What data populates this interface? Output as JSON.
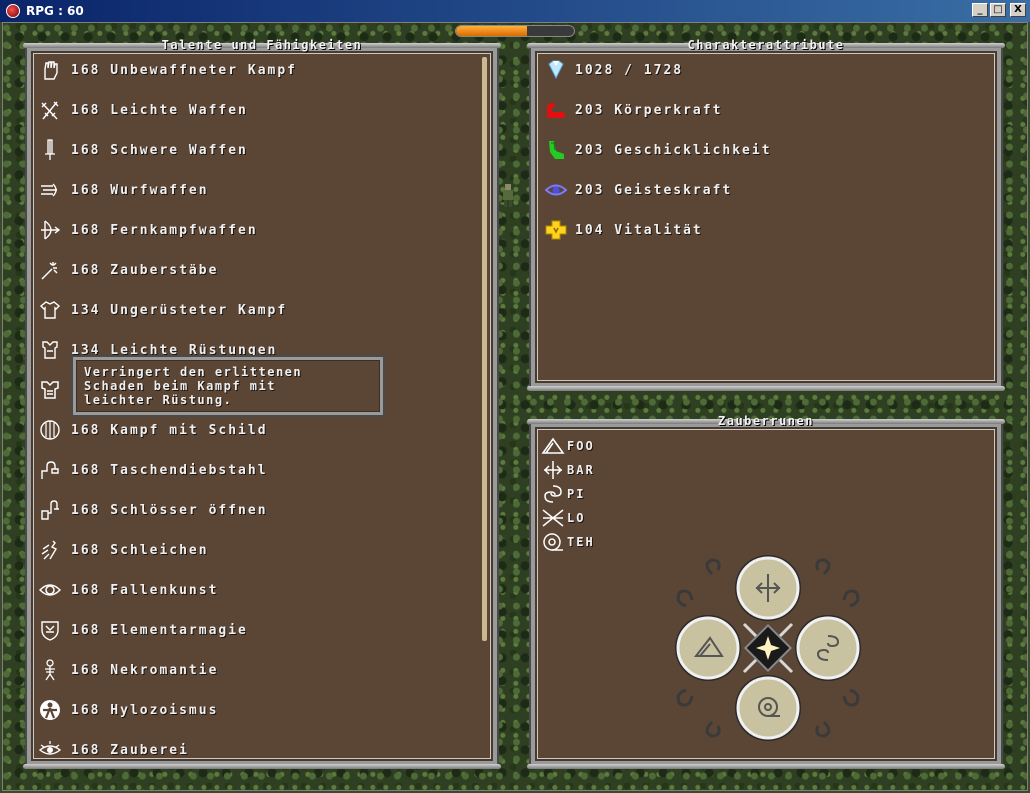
{
  "window": {
    "title": "RPG : 60",
    "btn_min": "_",
    "btn_max": "□",
    "btn_close": "X"
  },
  "hud": {
    "health_fraction": 0.6
  },
  "talents": {
    "title": "Talente und Fähigkeiten",
    "items": [
      {
        "value": "168",
        "name": "Unbewaffneter Kampf",
        "icon": "fist-icon"
      },
      {
        "value": "168",
        "name": "Leichte Waffen",
        "icon": "daggers-icon"
      },
      {
        "value": "168",
        "name": "Schwere Waffen",
        "icon": "sword-icon"
      },
      {
        "value": "168",
        "name": "Wurfwaffen",
        "icon": "throwing-star-icon"
      },
      {
        "value": "168",
        "name": "Fernkampfwaffen",
        "icon": "bow-icon"
      },
      {
        "value": "168",
        "name": "Zauberstäbe",
        "icon": "wand-icon"
      },
      {
        "value": "134",
        "name": "Ungerüsteter Kampf",
        "icon": "shirt-icon"
      },
      {
        "value": "134",
        "name": "Leichte Rüstungen",
        "icon": "light-armor-icon"
      },
      {
        "value": "",
        "name": "",
        "icon": "heavy-armor-icon"
      },
      {
        "value": "168",
        "name": "Kampf mit Schild",
        "icon": "shield-icon"
      },
      {
        "value": "168",
        "name": "Taschendiebstahl",
        "icon": "hand-icon"
      },
      {
        "value": "168",
        "name": "Schlösser öffnen",
        "icon": "lock-icon"
      },
      {
        "value": "168",
        "name": "Schleichen",
        "icon": "sneak-icon"
      },
      {
        "value": "168",
        "name": "Fallenkunst",
        "icon": "eye-trap-icon"
      },
      {
        "value": "168",
        "name": "Elementarmagie",
        "icon": "element-shield-icon"
      },
      {
        "value": "168",
        "name": "Nekromantie",
        "icon": "skeleton-icon"
      },
      {
        "value": "168",
        "name": "Hylozoismus",
        "icon": "nature-icon"
      },
      {
        "value": "168",
        "name": "Zauberei",
        "icon": "sorcery-eye-icon"
      }
    ],
    "tooltip": {
      "lines": [
        "Verringert den erlittenen",
        "Schaden beim Kampf mit",
        "leichter Rüstung."
      ]
    }
  },
  "attributes": {
    "title": "Charakterattribute",
    "items": [
      {
        "text": "1028 / 1728",
        "icon": "heart-crystal-icon",
        "color": "#a8e0ff"
      },
      {
        "text": "203 Körperkraft",
        "icon": "strength-arm-icon",
        "color": "#e01010"
      },
      {
        "text": "203 Geschicklichkeit",
        "icon": "dexterity-foot-icon",
        "color": "#22cc22"
      },
      {
        "text": "203 Geisteskraft",
        "icon": "mind-eye-icon",
        "color": "#6a6aff"
      },
      {
        "text": "104 Vitalität",
        "icon": "vitality-cross-icon",
        "color": "#ffd21c"
      }
    ]
  },
  "runes": {
    "title": "Zauberrunen",
    "items": [
      {
        "name": "FOO",
        "icon": "rune-triangle-icon"
      },
      {
        "name": "BAR",
        "icon": "rune-arrows-icon"
      },
      {
        "name": "PI",
        "icon": "rune-spiral-icon"
      },
      {
        "name": "LO",
        "icon": "rune-cross-icon"
      },
      {
        "name": "TEH",
        "icon": "rune-circle-icon"
      }
    ]
  }
}
